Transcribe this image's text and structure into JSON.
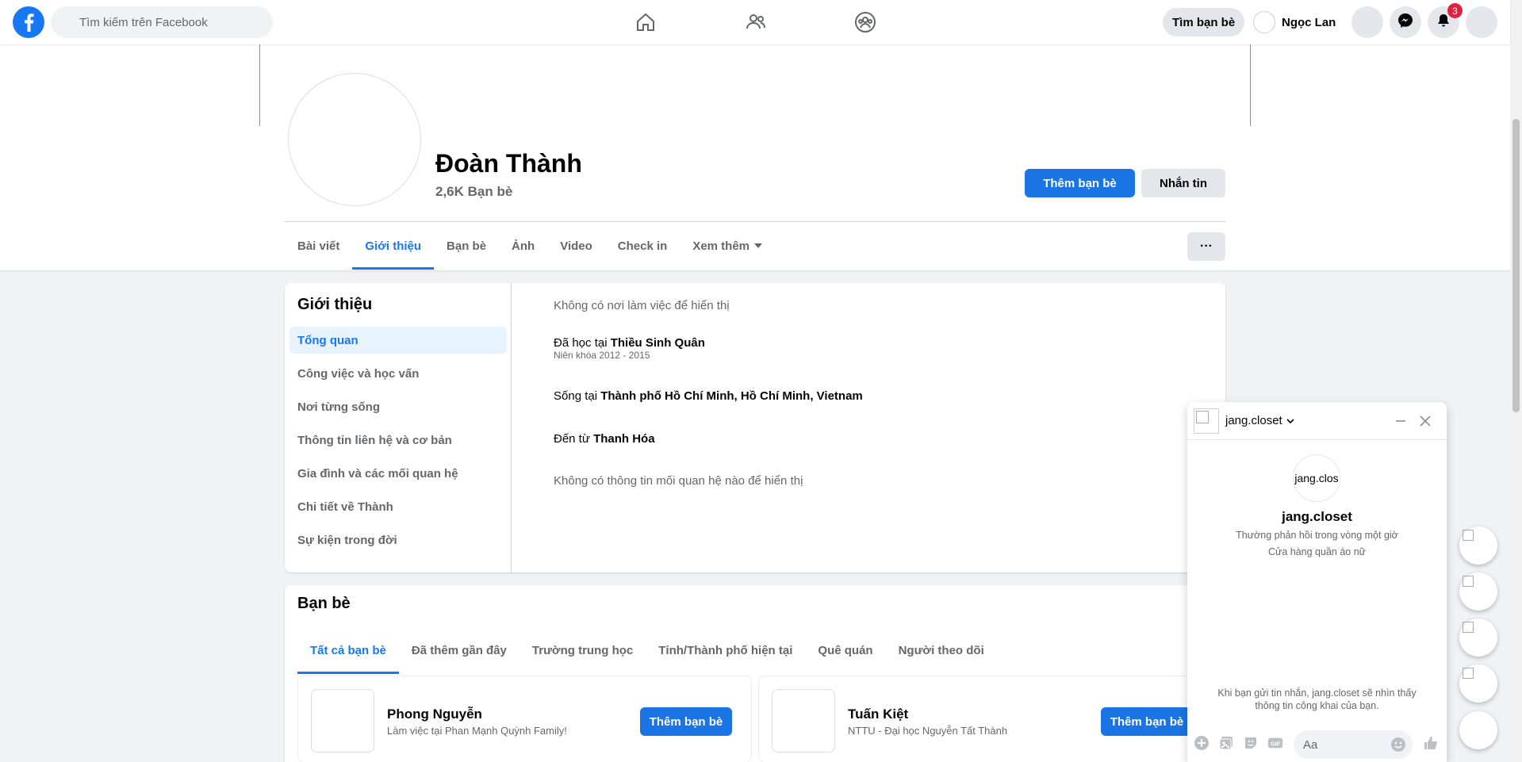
{
  "topbar": {
    "search_placeholder": "Tìm kiếm trên Facebook",
    "find_friends": "Tìm bạn bè",
    "user_name": "Ngọc Lan",
    "notification_count": "3"
  },
  "profile": {
    "name": "Đoàn Thành",
    "friends_count": "2,6K Bạn bè",
    "add_friend": "Thêm bạn bè",
    "message": "Nhắn tin",
    "more": "···"
  },
  "tabs": [
    "Bài viết",
    "Giới thiệu",
    "Bạn bè",
    "Ảnh",
    "Video",
    "Check in",
    "Xem thêm"
  ],
  "intro": {
    "title": "Giới thiệu",
    "nav": [
      "Tổng quan",
      "Công việc và học vấn",
      "Nơi từng sống",
      "Thông tin liên hệ và cơ bản",
      "Gia đình và các mối quan hệ",
      "Chi tiết về Thành",
      "Sự kiện trong đời"
    ],
    "no_work": "Không có nơi làm việc để hiển thị",
    "studied_prefix": "Đã học tại ",
    "studied_school": "Thiều Sinh Quân",
    "studied_years": "Niên khóa 2012 - 2015",
    "lives_prefix": "Sống tại ",
    "lives_place": "Thành phố Hồ Chí Minh, Hồ Chí Minh, Vietnam",
    "from_prefix": "Đến từ ",
    "from_place": "Thanh Hóa",
    "no_relationship": "Không có thông tin mối quan hệ nào để hiển thị"
  },
  "friends": {
    "title": "Bạn bè",
    "tabs": [
      "Tất cả bạn bè",
      "Đã thêm gần đây",
      "Trường trung học",
      "Tỉnh/Thành phố hiện tại",
      "Quê quán",
      "Người theo dõi"
    ],
    "list": [
      {
        "name": "Phong Nguyễn",
        "sub": "Làm việc tại Phan Mạnh Quỳnh Family!",
        "button": "Thêm bạn bè"
      },
      {
        "name": "Tuấn Kiệt",
        "sub": "NTTU - Đại học Nguyễn Tất Thành",
        "button": "Thêm bạn bè"
      }
    ]
  },
  "chat": {
    "header_name": "jang.closet",
    "avatar_text": "jang.clos",
    "name": "jang.closet",
    "reply_time": "Thường phản hồi trong vòng một giờ",
    "category": "Cửa hàng quần áo nữ",
    "notice": "Khi bạn gửi tin nhắn, jang.closet sẽ nhìn thấy thông tin công khai của bạn.",
    "input_placeholder": "Aa"
  },
  "colors": {
    "brand": "#1877f2",
    "button_primary": "#1b74e4",
    "badge": "#e41e3f"
  }
}
